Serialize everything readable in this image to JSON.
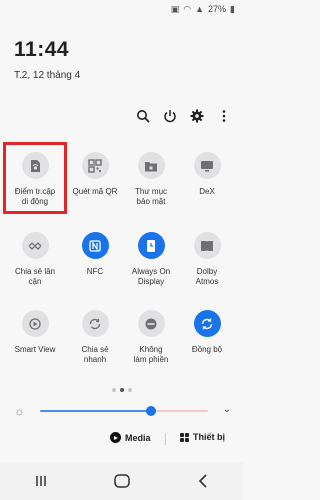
{
  "status": {
    "battery": "27%"
  },
  "clock": "11:44",
  "date": "T.2, 12 tháng 4",
  "top_actions": [
    {
      "name": "search-icon"
    },
    {
      "name": "power-icon"
    },
    {
      "name": "gear-icon"
    },
    {
      "name": "more-icon"
    }
  ],
  "tiles": [
    {
      "label": "Điểm tr.cập\ndi động",
      "state": "off",
      "icon": "mobile-hotspot-icon"
    },
    {
      "label": "Quét mã QR",
      "state": "off",
      "icon": "qr-scanner-icon"
    },
    {
      "label": "Thư mục\nbảo mật",
      "state": "off",
      "icon": "secure-folder-icon"
    },
    {
      "label": "DeX",
      "state": "off",
      "icon": "dex-icon"
    },
    {
      "label": "Chia sẻ lân\ncận",
      "state": "off",
      "icon": "nearby-share-icon"
    },
    {
      "label": "NFC",
      "state": "on",
      "icon": "nfc-icon"
    },
    {
      "label": "Always On\nDisplay",
      "state": "on",
      "icon": "always-on-display-icon"
    },
    {
      "label": "Dolby\nAtmos",
      "state": "off",
      "icon": "dolby-atmos-icon"
    },
    {
      "label": "Smart View",
      "state": "off",
      "icon": "smart-view-icon"
    },
    {
      "label": "Chia sẻ\nnhanh",
      "state": "off",
      "icon": "quick-share-icon"
    },
    {
      "label": "Không\nlàm phiền",
      "state": "off",
      "icon": "do-not-disturb-icon"
    },
    {
      "label": "Đồng bộ",
      "state": "on",
      "icon": "sync-icon"
    }
  ],
  "brightness": {
    "level": 0.66
  },
  "media": {
    "media_label": "Media",
    "devices_label": "Thiết bị"
  },
  "colors": {
    "accent": "#1a73e8",
    "highlight": "#e0262b",
    "tile_off": "#e1e1e3"
  }
}
